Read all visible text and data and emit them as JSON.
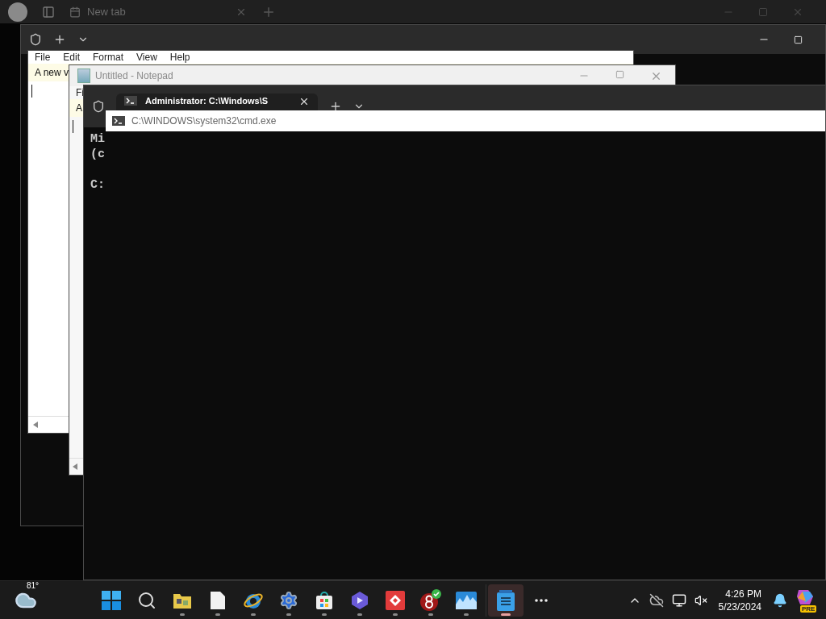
{
  "browser": {
    "tab_title": "New tab"
  },
  "notepad_back": {
    "menu": [
      "File",
      "Edit",
      "Format",
      "View",
      "Help"
    ],
    "text": "A new v"
  },
  "notepad": {
    "title": "Untitled - Notepad",
    "menu": [
      "Fi"
    ],
    "text": "A"
  },
  "terminal": {
    "tab_title": "Administrator: C:\\Windows\\S",
    "tooltip": "C:\\WINDOWS\\system32\\cmd.exe",
    "lines": [
      "Mi",
      "(c"
    ],
    "prompt": "C:"
  },
  "taskbar": {
    "weather": {
      "temp": "81°"
    },
    "apps": [
      {
        "kind": "start",
        "running": false,
        "selected": false
      },
      {
        "kind": "search",
        "running": false,
        "selected": false
      },
      {
        "kind": "explorer",
        "running": true,
        "selected": false
      },
      {
        "kind": "file",
        "running": true,
        "selected": false
      },
      {
        "kind": "ie",
        "running": true,
        "selected": false
      },
      {
        "kind": "settings",
        "running": true,
        "selected": false
      },
      {
        "kind": "store",
        "running": true,
        "selected": false
      },
      {
        "kind": "copilot",
        "running": true,
        "selected": false
      },
      {
        "kind": "redapp",
        "running": true,
        "selected": false
      },
      {
        "kind": "eightapp",
        "running": true,
        "selected": false
      },
      {
        "kind": "chart",
        "running": true,
        "selected": false
      },
      {
        "kind": "notepad",
        "running": true,
        "selected": true
      },
      {
        "kind": "more",
        "running": false,
        "selected": false
      }
    ],
    "clock": {
      "time": "4:26 PM",
      "date": "5/23/2024"
    },
    "copilot_badge": "PRE"
  }
}
